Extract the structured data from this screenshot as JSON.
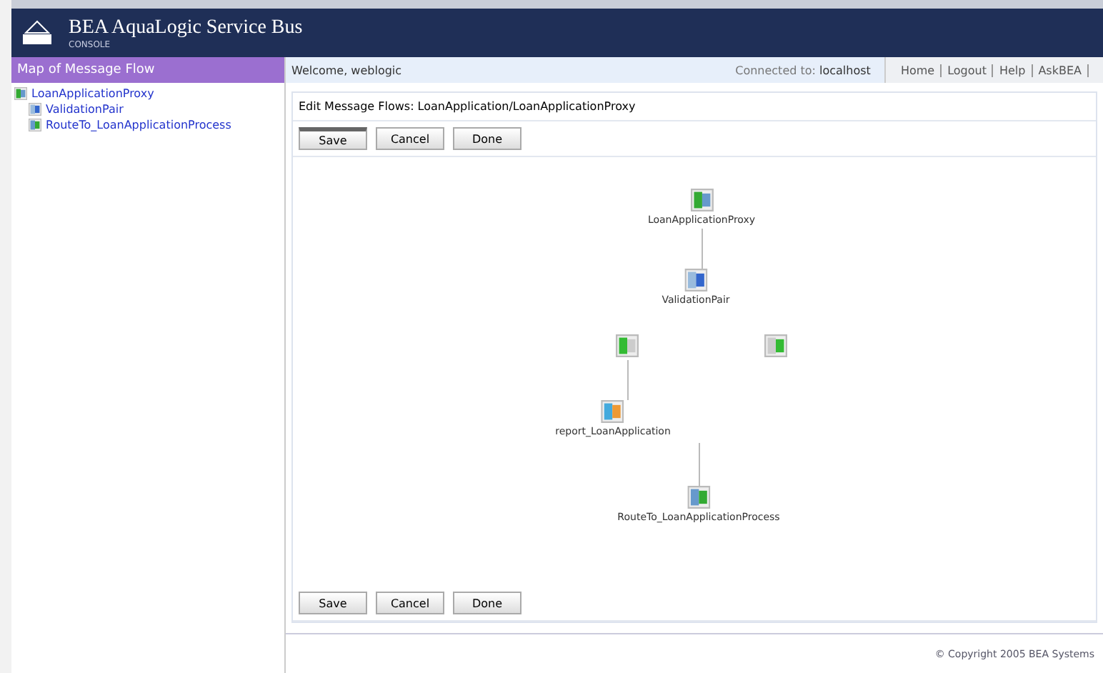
{
  "header": {
    "title": "BEA AquaLogic Service Bus",
    "subtitle": "CONSOLE"
  },
  "sidebar": {
    "title": "Map of Message Flow",
    "tree": [
      {
        "label": "LoanApplicationProxy",
        "kind": "proxy",
        "children": [
          {
            "label": "ValidationPair",
            "kind": "pair"
          },
          {
            "label": "RouteTo_LoanApplicationProcess",
            "kind": "route"
          }
        ]
      }
    ]
  },
  "topbar": {
    "welcome": "Welcome, weblogic",
    "connected_label": "Connected to:",
    "connected_value": "localhost",
    "links": [
      "Home",
      "Logout",
      "Help",
      "AskBEA"
    ]
  },
  "page_title": "Edit Message Flows: LoanApplication/LoanApplicationProxy",
  "top_buttons": [
    {
      "label": "Save",
      "selected": true
    },
    {
      "label": "Cancel",
      "selected": false
    },
    {
      "label": "Done",
      "selected": false
    }
  ],
  "flow": {
    "nodes": [
      {
        "kind": "proxy",
        "label": "LoanApplicationProxy"
      },
      {
        "kind": "pair",
        "label": "ValidationPair"
      },
      {
        "kind": "request"
      },
      {
        "kind": "response"
      },
      {
        "kind": "stage",
        "label": "report_LoanApplication"
      },
      {
        "kind": "route",
        "label": "RouteTo_LoanApplicationProcess"
      }
    ]
  },
  "bottom_buttons": [
    {
      "label": "Save",
      "selected": false
    },
    {
      "label": "Cancel",
      "selected": false
    },
    {
      "label": "Done",
      "selected": false
    }
  ],
  "footer": "© Copyright 2005 BEA Systems"
}
